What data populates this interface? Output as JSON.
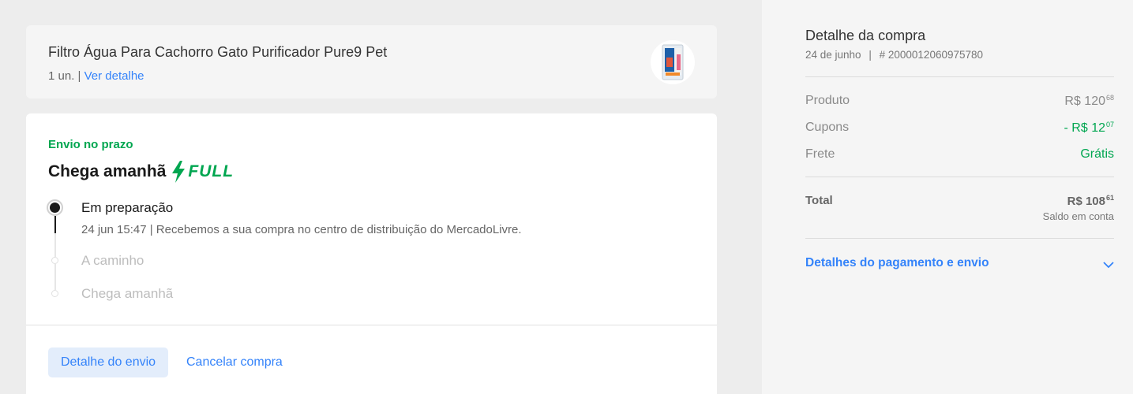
{
  "product": {
    "title": "Filtro Água Para Cachorro Gato Purificador Pure9 Pet",
    "quantity": "1 un.",
    "separator": "|",
    "detail_link": "Ver detalhe"
  },
  "shipment": {
    "status_label": "Envio no prazo",
    "arrival": "Chega amanhã",
    "badge": "FULL",
    "steps": [
      {
        "title": "Em preparação",
        "detail": "24 jun 15:47 | Recebemos a sua compra no centro de distribuição do MercadoLivre."
      },
      {
        "title": "A caminho"
      },
      {
        "title": "Chega amanhã"
      }
    ],
    "detail_button": "Detalhe do envio",
    "cancel_button": "Cancelar compra"
  },
  "summary": {
    "title": "Detalhe da compra",
    "date": "24 de junho",
    "separator": "|",
    "order_number": "# 2000012060975780",
    "rows": [
      {
        "label": "Produto",
        "value_main": "R$ 120",
        "value_cents": "68"
      },
      {
        "label": "Cupons",
        "value_main": "- R$ 12",
        "value_cents": "07"
      },
      {
        "label": "Frete",
        "value_main": "Grátis",
        "value_cents": ""
      }
    ],
    "total_label": "Total",
    "total_main": "R$ 108",
    "total_cents": "61",
    "total_note": "Saldo em conta",
    "payment_details": "Detalhes do pagamento e envio"
  },
  "colors": {
    "accent_blue": "#3483fa",
    "success_green": "#00a650",
    "background": "#ededed"
  },
  "icons": [
    "bolt-icon",
    "chevron-down-icon",
    "product-thumbnail"
  ]
}
